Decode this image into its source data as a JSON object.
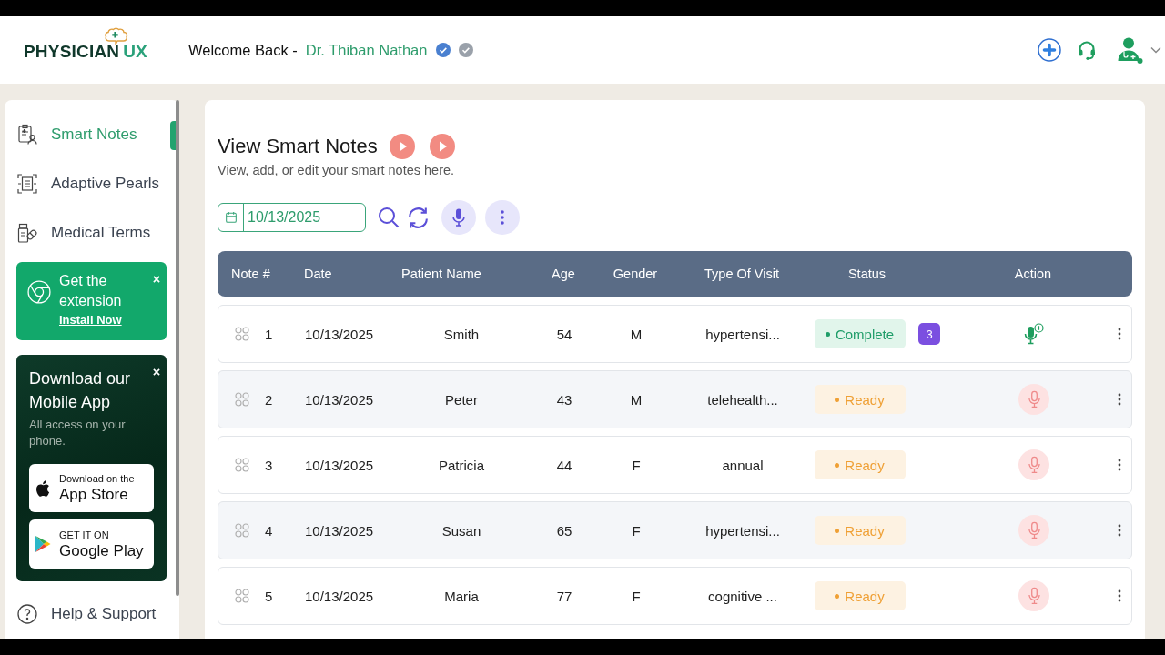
{
  "header": {
    "logo": {
      "name": "PHYSICIAN",
      "accent": "UX"
    },
    "greeting": "Welcome Back -",
    "user_name": "Dr. Thiban Nathan"
  },
  "sidebar": {
    "items": [
      {
        "label": "Smart Notes",
        "selected": true
      },
      {
        "label": "Adaptive Pearls",
        "selected": false
      },
      {
        "label": "Medical Terms",
        "selected": false
      }
    ],
    "extension_card": {
      "title": "Get the extension",
      "link": "Install Now"
    },
    "app_card": {
      "title": "Download our Mobile App",
      "text": "All access on your phone.",
      "stores": [
        {
          "kind": "apple",
          "caption": "Download on the",
          "name": "App Store"
        },
        {
          "kind": "google",
          "caption": "GET IT ON",
          "name": "Google Play"
        }
      ]
    },
    "help": "Help & Support"
  },
  "page": {
    "title": "View Smart Notes",
    "subtitle": "View, add, or edit your smart notes here.",
    "date_filter": "10/13/2025"
  },
  "table": {
    "columns": [
      "Note #",
      "Date",
      "Patient Name",
      "Age",
      "Gender",
      "Type Of Visit",
      "Status",
      "Action"
    ],
    "rows": [
      {
        "number": "1",
        "date": "10/13/2025",
        "patient": "Smith",
        "age": "54",
        "gender": "M",
        "visit": "hypertensi...",
        "status": {
          "label": "Complete",
          "kind": "complete"
        },
        "count": "3"
      },
      {
        "number": "2",
        "date": "10/13/2025",
        "patient": "Peter",
        "age": "43",
        "gender": "M",
        "visit": "telehealth...",
        "status": {
          "label": "Ready",
          "kind": "ready"
        }
      },
      {
        "number": "3",
        "date": "10/13/2025",
        "patient": "Patricia",
        "age": "44",
        "gender": "F",
        "visit": "annual",
        "status": {
          "label": "Ready",
          "kind": "ready"
        }
      },
      {
        "number": "4",
        "date": "10/13/2025",
        "patient": "Susan",
        "age": "65",
        "gender": "F",
        "visit": "hypertensi...",
        "status": {
          "label": "Ready",
          "kind": "ready"
        }
      },
      {
        "number": "5",
        "date": "10/13/2025",
        "patient": "Maria",
        "age": "77",
        "gender": "F",
        "visit": "cognitive ...",
        "status": {
          "label": "Ready",
          "kind": "ready"
        }
      }
    ]
  }
}
